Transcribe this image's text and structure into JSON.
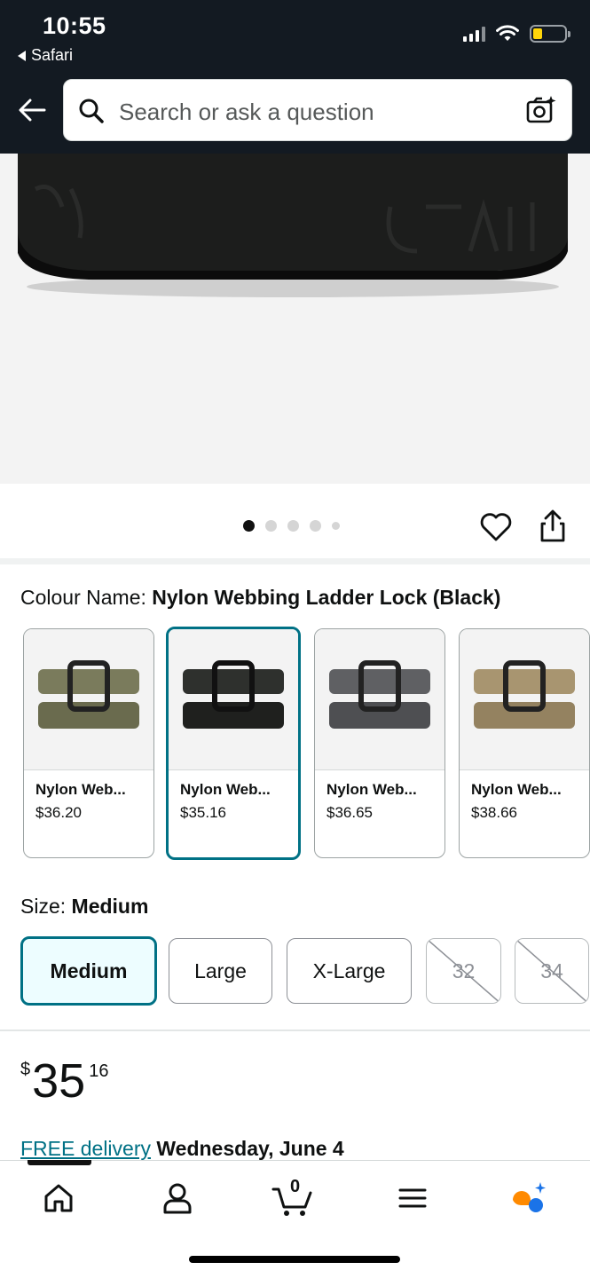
{
  "status_bar": {
    "time": "10:55",
    "back_app": "Safari"
  },
  "search": {
    "placeholder": "Search or ask a question"
  },
  "gallery": {
    "dot_count": 5,
    "active_dot": 1
  },
  "colour": {
    "label": "Colour Name:",
    "selected_value": "Nylon Webbing Ladder Lock (Black)",
    "variants": [
      {
        "name": "Nylon Web...",
        "price": "$36.20",
        "color": "#7a7b5c"
      },
      {
        "name": "Nylon Web...",
        "price": "$35.16",
        "color": "#2e302d"
      },
      {
        "name": "Nylon Web...",
        "price": "$36.65",
        "color": "#5f6063"
      },
      {
        "name": "Nylon Web...",
        "price": "$38.66",
        "color": "#a89570"
      }
    ]
  },
  "size": {
    "label": "Size:",
    "selected_value": "Medium",
    "options": [
      {
        "label": "Medium",
        "state": "selected"
      },
      {
        "label": "Large",
        "state": "available"
      },
      {
        "label": "X-Large",
        "state": "available"
      },
      {
        "label": "32",
        "state": "unavailable"
      },
      {
        "label": "34",
        "state": "unavailable"
      }
    ]
  },
  "price": {
    "symbol": "$",
    "whole": "35",
    "fraction": "16"
  },
  "delivery": {
    "link_text": "FREE delivery",
    "date": "Wednesday, June 4"
  },
  "bottom_nav": {
    "cart_count": "0",
    "items": [
      "home-icon",
      "account-icon",
      "cart-icon",
      "menu-icon",
      "rufus-icon"
    ]
  },
  "colors": {
    "header_bg": "#131a22",
    "accent_teal": "#007185",
    "selected_bg": "#edfdff"
  }
}
